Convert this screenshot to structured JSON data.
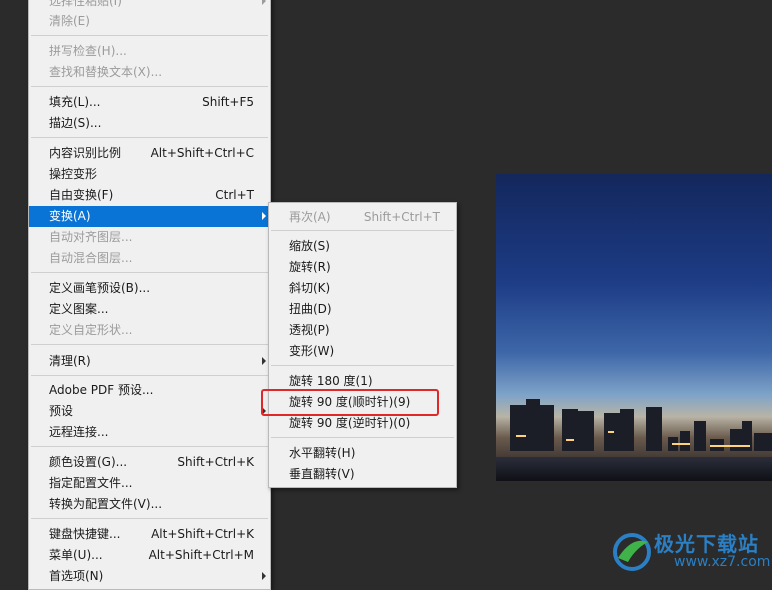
{
  "edit_menu": {
    "items": [
      {
        "label": "选择性粘贴(I)",
        "disabled": true,
        "submenu": true
      },
      {
        "label": "清除(E)",
        "disabled": true
      },
      {
        "label": "拼写检查(H)...",
        "disabled": true
      },
      {
        "label": "查找和替换文本(X)...",
        "disabled": true
      },
      {
        "label": "填充(L)...",
        "shortcut": "Shift+F5"
      },
      {
        "label": "描边(S)..."
      },
      {
        "label": "内容识别比例",
        "shortcut": "Alt+Shift+Ctrl+C"
      },
      {
        "label": "操控变形"
      },
      {
        "label": "自由变换(F)",
        "shortcut": "Ctrl+T"
      },
      {
        "label": "变换(A)",
        "highlighted": true,
        "submenu": true
      },
      {
        "label": "自动对齐图层...",
        "disabled": true
      },
      {
        "label": "自动混合图层...",
        "disabled": true
      },
      {
        "label": "定义画笔预设(B)..."
      },
      {
        "label": "定义图案..."
      },
      {
        "label": "定义自定形状...",
        "disabled": true
      },
      {
        "label": "清理(R)",
        "submenu": true
      },
      {
        "label": "Adobe PDF 预设..."
      },
      {
        "label": "预设",
        "submenu": true
      },
      {
        "label": "远程连接..."
      },
      {
        "label": "颜色设置(G)...",
        "shortcut": "Shift+Ctrl+K"
      },
      {
        "label": "指定配置文件..."
      },
      {
        "label": "转换为配置文件(V)..."
      },
      {
        "label": "键盘快捷键...",
        "shortcut": "Alt+Shift+Ctrl+K"
      },
      {
        "label": "菜单(U)...",
        "shortcut": "Alt+Shift+Ctrl+M"
      },
      {
        "label": "首选项(N)",
        "submenu": true
      }
    ]
  },
  "transform_menu": {
    "items": [
      {
        "label": "再次(A)",
        "shortcut": "Shift+Ctrl+T",
        "disabled": true
      },
      {
        "label": "缩放(S)"
      },
      {
        "label": "旋转(R)"
      },
      {
        "label": "斜切(K)"
      },
      {
        "label": "扭曲(D)"
      },
      {
        "label": "透视(P)"
      },
      {
        "label": "变形(W)"
      },
      {
        "label": "旋转 180 度(1)"
      },
      {
        "label": "旋转 90 度(顺时针)(9)",
        "boxed": true
      },
      {
        "label": "旋转 90 度(逆时针)(0)"
      },
      {
        "label": "水平翻转(H)"
      },
      {
        "label": "垂直翻转(V)"
      }
    ]
  },
  "watermark": {
    "title": "极光下载站",
    "url": "www.xz7.com"
  },
  "colors": {
    "highlight": "#0a74d6",
    "annotation_box": "#e02828",
    "canvas_bg": "#2b2b2b"
  }
}
